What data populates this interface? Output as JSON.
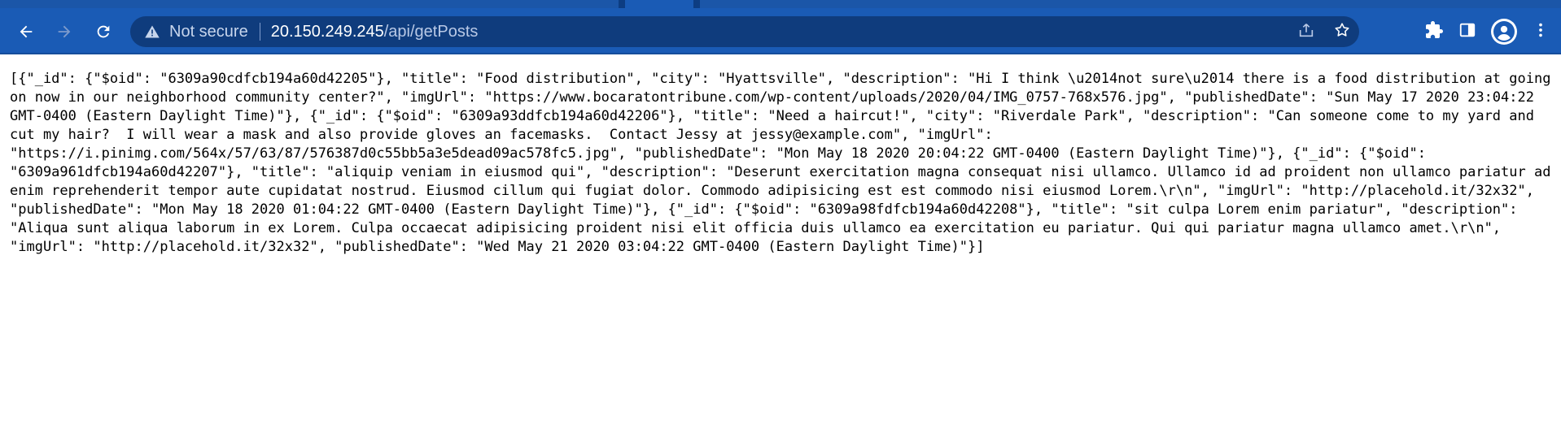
{
  "browser": {
    "security_label": "Not secure",
    "url_host": "20.150.249.245",
    "url_path": "/api/getPosts",
    "icons": {
      "back": "arrow-left-icon",
      "forward": "arrow-right-icon",
      "reload": "reload-icon",
      "security": "warning-triangle-icon",
      "share": "share-icon",
      "bookmark": "star-icon",
      "extensions": "puzzle-icon",
      "side_panel": "side-panel-icon",
      "profile": "avatar-icon",
      "menu": "kebab-menu-icon"
    },
    "colors": {
      "toolbar": "#1a5bb5",
      "omnibox": "#0f3c7d",
      "tabstrip": "#0d3d82"
    }
  },
  "page": {
    "json_text": "[{\"_id\": {\"$oid\": \"6309a90cdfcb194a60d42205\"}, \"title\": \"Food distribution\", \"city\": \"Hyattsville\", \"description\": \"Hi I think \\u2014not sure\\u2014 there is a food distribution at going on now in our neighborhood community center?\", \"imgUrl\": \"https://www.bocaratontribune.com/wp-content/uploads/2020/04/IMG_0757-768x576.jpg\", \"publishedDate\": \"Sun May 17 2020 23:04:22 GMT-0400 (Eastern Daylight Time)\"}, {\"_id\": {\"$oid\": \"6309a93ddfcb194a60d42206\"}, \"title\": \"Need a haircut!\", \"city\": \"Riverdale Park\", \"description\": \"Can someone come to my yard and cut my hair?  I will wear a mask and also provide gloves an facemasks.  Contact Jessy at jessy@example.com\", \"imgUrl\": \"https://i.pinimg.com/564x/57/63/87/576387d0c55bb5a3e5dead09ac578fc5.jpg\", \"publishedDate\": \"Mon May 18 2020 20:04:22 GMT-0400 (Eastern Daylight Time)\"}, {\"_id\": {\"$oid\": \"6309a961dfcb194a60d42207\"}, \"title\": \"aliquip veniam in eiusmod qui\", \"description\": \"Deserunt exercitation magna consequat nisi ullamco. Ullamco id ad proident non ullamco pariatur ad enim reprehenderit tempor aute cupidatat nostrud. Eiusmod cillum qui fugiat dolor. Commodo adipisicing est est commodo nisi eiusmod Lorem.\\r\\n\", \"imgUrl\": \"http://placehold.it/32x32\", \"publishedDate\": \"Mon May 18 2020 01:04:22 GMT-0400 (Eastern Daylight Time)\"}, {\"_id\": {\"$oid\": \"6309a98fdfcb194a60d42208\"}, \"title\": \"sit culpa Lorem enim pariatur\", \"description\": \"Aliqua sunt aliqua laborum in ex Lorem. Culpa occaecat adipisicing proident nisi elit officia duis ullamco ea exercitation eu pariatur. Qui qui pariatur magna ullamco amet.\\r\\n\", \"imgUrl\": \"http://placehold.it/32x32\", \"publishedDate\": \"Wed May 21 2020 03:04:22 GMT-0400 (Eastern Daylight Time)\"}]"
  }
}
